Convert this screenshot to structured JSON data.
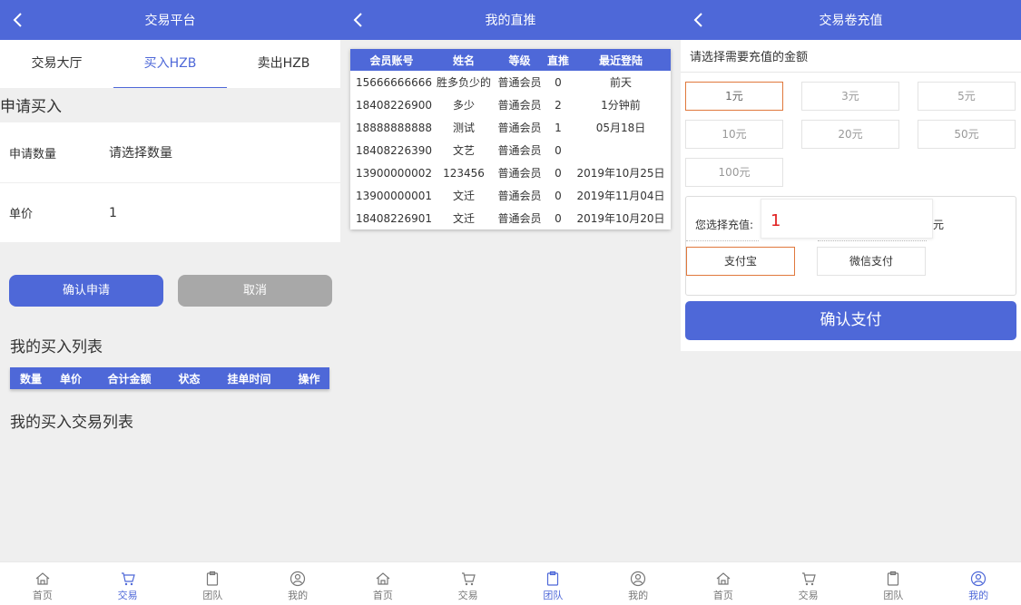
{
  "nav": [
    "首页",
    "交易",
    "团队",
    "我的"
  ],
  "trade": {
    "title": "交易平台",
    "tabs": [
      "交易大厅",
      "买入HZB",
      "卖出HZB"
    ],
    "apply_title": "申请买入",
    "qty_label": "申请数量",
    "qty_value": "请选择数量",
    "price_label": "单价",
    "price_value": "1",
    "confirm_label": "确认申请",
    "cancel_label": "取消",
    "list_title": "我的买入列表",
    "list_columns": [
      "数量",
      "单价",
      "合计金额",
      "状态",
      "挂单时间",
      "操作"
    ],
    "list_title2": "我的买入交易列表"
  },
  "team": {
    "title": "我的直推",
    "columns": [
      "会员账号",
      "姓名",
      "等级",
      "直推",
      "最近登陆"
    ],
    "rows": [
      [
        "15666666666",
        "胜多负少的",
        "普通会员",
        "0",
        "前天"
      ],
      [
        "18408226900",
        "多少",
        "普通会员",
        "2",
        "1分钟前"
      ],
      [
        "18888888888",
        "测试",
        "普通会员",
        "1",
        "05月18日"
      ],
      [
        "18408226390",
        "文艺",
        "普通会员",
        "0",
        ""
      ],
      [
        "13900000002",
        "123456",
        "普通会员",
        "0",
        "2019年10月25日"
      ],
      [
        "13900000001",
        "文迁",
        "普通会员",
        "0",
        "2019年11月04日"
      ],
      [
        "18408226901",
        "文迁",
        "普通会员",
        "0",
        "2019年10月20日"
      ]
    ]
  },
  "recharge": {
    "title": "交易卷充值",
    "hint": "请选择需要充值的金额",
    "amounts": [
      "1元",
      "3元",
      "5元",
      "10元",
      "20元",
      "50元",
      "100元"
    ],
    "selected_label": "您选择充值:",
    "selected_value": "1",
    "unit": "元",
    "pay_alipay": "支付宝",
    "pay_wechat": "微信支付",
    "confirm_label": "确认支付"
  },
  "colors": {
    "brand": "#4e68d8",
    "accent": "#e0783c",
    "danger": "#e02020"
  },
  "icons": {
    "back": "chevron-left-icon",
    "home": "home-icon",
    "trade": "cart-icon",
    "team": "clipboard-icon",
    "mine": "user-icon"
  }
}
